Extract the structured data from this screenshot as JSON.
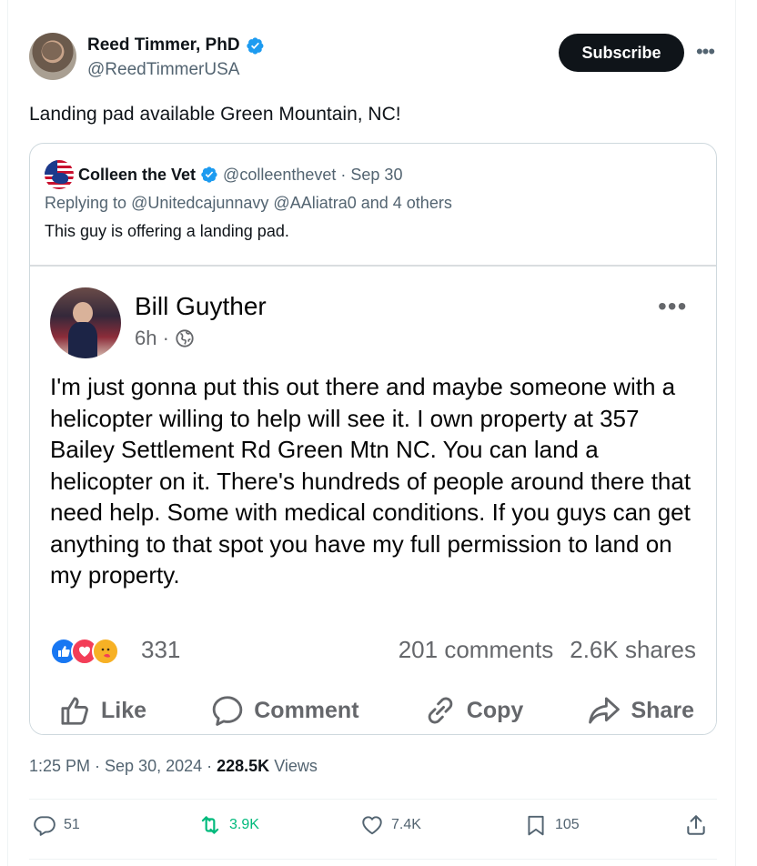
{
  "author": {
    "display_name": "Reed Timmer, PhD",
    "handle": "@ReedTimmerUSA",
    "verified": true
  },
  "subscribe_label": "Subscribe",
  "tweet_text": "Landing pad available Green Mountain, NC!",
  "quoted": {
    "name": "Colleen the Vet",
    "handle": "@colleenthevet",
    "date": "· Sep 30",
    "replying_prefix": "Replying to",
    "replying_to": "@Unitedcajunnavy @AAliatra0 and 4 others",
    "text": "This guy is offering a landing pad."
  },
  "facebook_post": {
    "name": "Bill Guyther",
    "time": "6h ·",
    "body": "I'm just gonna put this out there and maybe someone with a helicopter willing to help will see it. I own property at 357 Bailey Settlement Rd Green Mtn NC. You can land a helicopter on it. There's hundreds of people around there that need help. Some with medical conditions. If you guys can get anything to that spot you have my full permission to land on my property.",
    "reactions_count": "331",
    "comments": "201 comments",
    "shares": "2.6K shares",
    "actions": {
      "like": "Like",
      "comment": "Comment",
      "copy": "Copy",
      "share": "Share"
    }
  },
  "meta": {
    "time": "1:25 PM · Sep 30, 2024 ·",
    "views_count": "228.5K",
    "views_label": "Views"
  },
  "engagement": {
    "replies": "51",
    "reposts": "3.9K",
    "likes": "7.4K",
    "bookmarks": "105"
  },
  "colors": {
    "verified": "#1d9bf0",
    "retweet": "#00ba7c",
    "subscribe_bg": "#0f1419",
    "fb_like": "#1877f2",
    "fb_love": "#f33e58",
    "fb_care": "#f7b125"
  },
  "icons": [
    "verified-badge-icon",
    "more-icon",
    "flag-avatar-icon",
    "globe-icon",
    "thumbs-up-icon",
    "comment-bubble-icon",
    "link-icon",
    "share-arrow-icon",
    "reply-icon",
    "retweet-icon",
    "heart-icon",
    "bookmark-icon",
    "upload-icon"
  ]
}
